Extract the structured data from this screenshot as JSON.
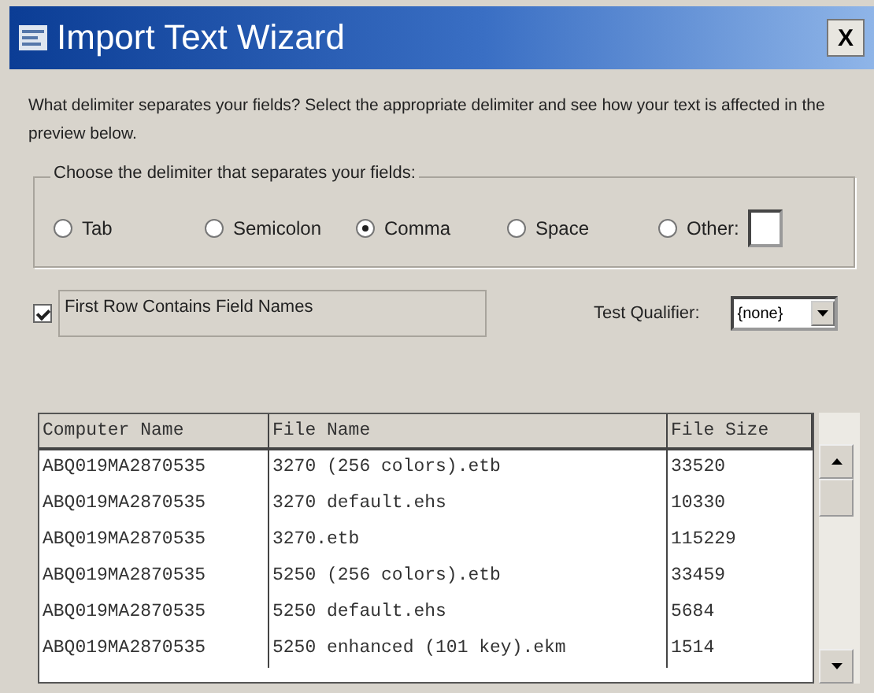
{
  "window": {
    "title": "Import Text Wizard",
    "close": "X"
  },
  "instructions": "What delimiter separates your fields? Select the appropriate delimiter and see how your text is affected in the preview below.",
  "delimiter_group": {
    "legend": "Choose the delimiter that separates your fields:",
    "options": [
      {
        "label": "Tab",
        "selected": false
      },
      {
        "label": "Semicolon",
        "selected": false
      },
      {
        "label": "Comma",
        "selected": true
      },
      {
        "label": "Space",
        "selected": false
      },
      {
        "label": "Other:",
        "selected": false
      }
    ]
  },
  "first_row_field_names": {
    "label": "First Row Contains Field Names",
    "checked": true
  },
  "text_qualifier": {
    "label": "Test Qualifier:",
    "value": "{none}"
  },
  "table": {
    "columns": [
      "Computer Name",
      "File Name",
      "File Size"
    ],
    "rows": [
      [
        "ABQ019MA2870535",
        "3270 (256 colors).etb",
        "33520"
      ],
      [
        "ABQ019MA2870535",
        "3270 default.ehs",
        "10330"
      ],
      [
        "ABQ019MA2870535",
        "3270.etb",
        "115229"
      ],
      [
        "ABQ019MA2870535",
        "5250 (256 colors).etb",
        "33459"
      ],
      [
        "ABQ019MA2870535",
        "5250 default.ehs",
        "5684"
      ],
      [
        "ABQ019MA2870535",
        "5250 enhanced (101 key).ekm",
        "1514"
      ]
    ]
  }
}
